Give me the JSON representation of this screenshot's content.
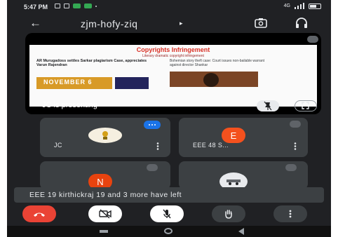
{
  "status_bar": {
    "time": "5:47 PM",
    "network": "4G",
    "battery_icon": "battery-icon"
  },
  "top_bar": {
    "back_icon": "arrow-left-icon",
    "meeting_code": "zjm-hofy-ziq",
    "caret": "▸",
    "camera_switch_icon": "switch-camera-icon",
    "audio_icon": "headphones-icon"
  },
  "presentation": {
    "label": "JC is presenting",
    "slide": {
      "title": "Copyrights Infringement",
      "subtitle": "Literary dramatic copyright infringement",
      "left_headline": "AR Murugadoss settles Sarkar plagiarism Case, appreciates Varun Rajendran",
      "banner_text": "NOVEMBER 6",
      "right_headline": "Bohemian story theft case: Court issues non-bailable warrant against director Shankar"
    },
    "pin_icon": "pin-off-icon",
    "fullscreen_icon": "fullscreen-icon",
    "mic_status_icon": "mic-off-icon"
  },
  "participants": [
    {
      "name": "JC",
      "avatar_letter": "",
      "speaking": true,
      "avatar_color": "#f5efe0"
    },
    {
      "name": "EEE 48 S...",
      "avatar_letter": "E",
      "speaking": false,
      "avatar_color": "#f4511e"
    },
    {
      "name": "",
      "avatar_letter": "N",
      "speaking": false,
      "avatar_color": "#e8430f"
    },
    {
      "name": "",
      "avatar_letter": "",
      "speaking": false,
      "avatar_color": "#e8eaed"
    }
  ],
  "toast": {
    "message": "EEE 19 kirthickraj 19 and 3 more have left"
  },
  "controls": {
    "end_call_icon": "end-call-icon",
    "camera_icon": "camera-off-icon",
    "mic_icon": "mic-off-icon",
    "raise_hand_icon": "raise-hand-icon",
    "more_icon": "more-vert-icon",
    "end_call_color": "#ea4335"
  }
}
